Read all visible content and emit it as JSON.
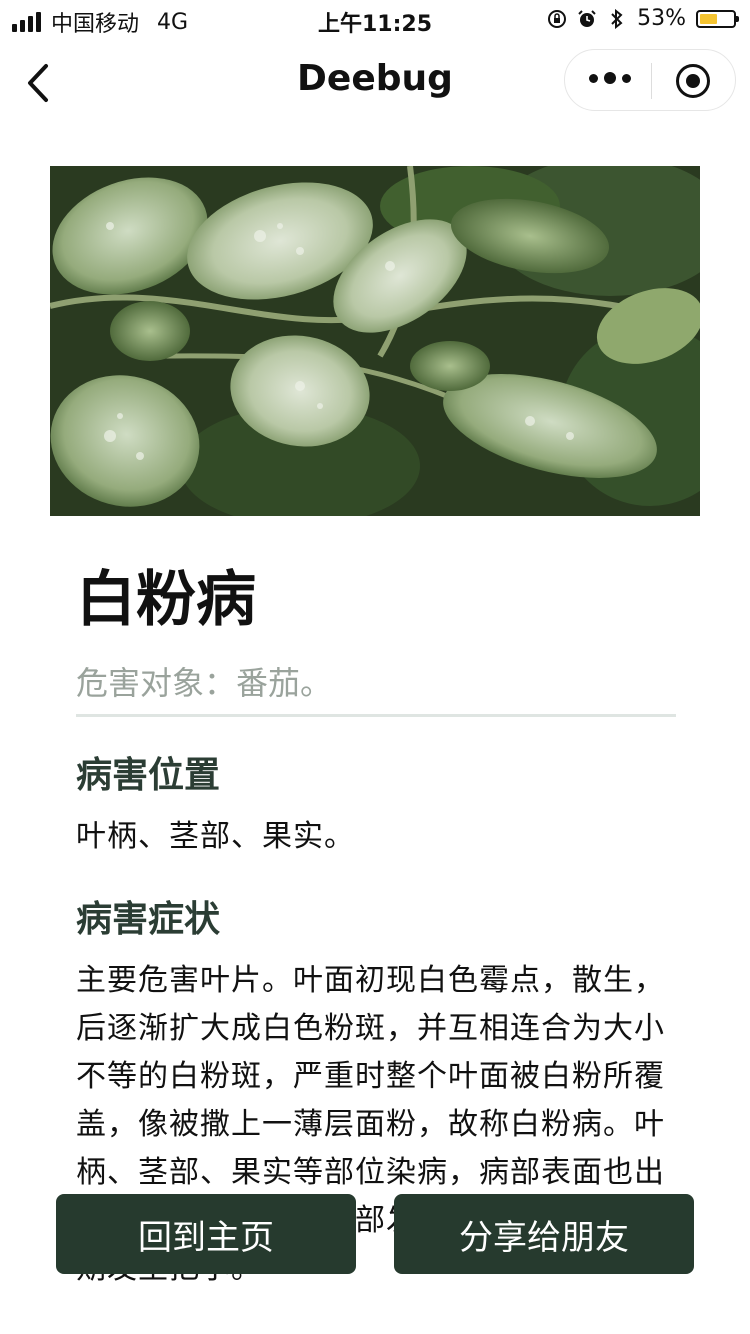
{
  "status_bar": {
    "carrier": "中国移动",
    "network": "4G",
    "time": "上午11:25",
    "battery_percent": "53%",
    "battery_level": 0.53,
    "battery_color": "#f5c431"
  },
  "nav": {
    "title": "Deebug",
    "back_icon": "chevron-left-icon",
    "more_icon": "more-dots-icon",
    "close_icon": "target-circle-icon"
  },
  "hero": {
    "icon": "plant-leaves-photo"
  },
  "disease": {
    "name": "白粉病",
    "target": "危害对象：番茄。",
    "sections": [
      {
        "heading": "病害位置",
        "body": "叶柄、茎部、果实。"
      },
      {
        "heading": "病害症状",
        "body": "主要危害叶片。叶面初现白色霉点，散生，后逐渐扩大成白色粉斑，并互相连合为大小不等的白粉斑，严重时整个叶面被白粉所覆盖，像被撒上一薄层面粉，故称白粉病。叶柄、茎部、果实等部位染病，病部表面也出现白粉状物。后期病部发生黑色小粒点，后期发生把小。"
      }
    ]
  },
  "buttons": {
    "home": "回到主页",
    "share": "分享给朋友"
  },
  "colors": {
    "button_bg": "#263a2e",
    "heading": "#2b3d34",
    "muted": "#9aa39c"
  }
}
